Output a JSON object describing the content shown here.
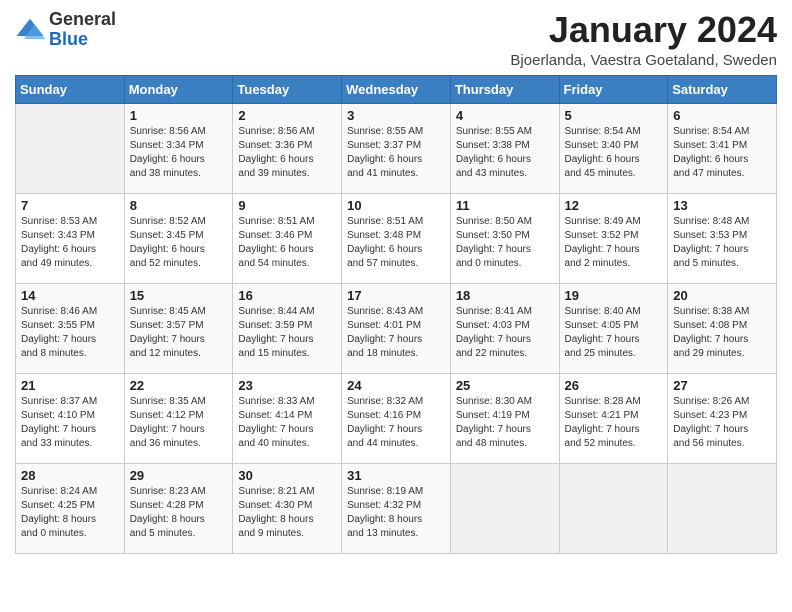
{
  "header": {
    "logo_general": "General",
    "logo_blue": "Blue",
    "month_year": "January 2024",
    "location": "Bjoerlanda, Vaestra Goetaland, Sweden"
  },
  "days_of_week": [
    "Sunday",
    "Monday",
    "Tuesday",
    "Wednesday",
    "Thursday",
    "Friday",
    "Saturday"
  ],
  "weeks": [
    [
      {
        "day": "",
        "info": ""
      },
      {
        "day": "1",
        "info": "Sunrise: 8:56 AM\nSunset: 3:34 PM\nDaylight: 6 hours\nand 38 minutes."
      },
      {
        "day": "2",
        "info": "Sunrise: 8:56 AM\nSunset: 3:36 PM\nDaylight: 6 hours\nand 39 minutes."
      },
      {
        "day": "3",
        "info": "Sunrise: 8:55 AM\nSunset: 3:37 PM\nDaylight: 6 hours\nand 41 minutes."
      },
      {
        "day": "4",
        "info": "Sunrise: 8:55 AM\nSunset: 3:38 PM\nDaylight: 6 hours\nand 43 minutes."
      },
      {
        "day": "5",
        "info": "Sunrise: 8:54 AM\nSunset: 3:40 PM\nDaylight: 6 hours\nand 45 minutes."
      },
      {
        "day": "6",
        "info": "Sunrise: 8:54 AM\nSunset: 3:41 PM\nDaylight: 6 hours\nand 47 minutes."
      }
    ],
    [
      {
        "day": "7",
        "info": "Sunrise: 8:53 AM\nSunset: 3:43 PM\nDaylight: 6 hours\nand 49 minutes."
      },
      {
        "day": "8",
        "info": "Sunrise: 8:52 AM\nSunset: 3:45 PM\nDaylight: 6 hours\nand 52 minutes."
      },
      {
        "day": "9",
        "info": "Sunrise: 8:51 AM\nSunset: 3:46 PM\nDaylight: 6 hours\nand 54 minutes."
      },
      {
        "day": "10",
        "info": "Sunrise: 8:51 AM\nSunset: 3:48 PM\nDaylight: 6 hours\nand 57 minutes."
      },
      {
        "day": "11",
        "info": "Sunrise: 8:50 AM\nSunset: 3:50 PM\nDaylight: 7 hours\nand 0 minutes."
      },
      {
        "day": "12",
        "info": "Sunrise: 8:49 AM\nSunset: 3:52 PM\nDaylight: 7 hours\nand 2 minutes."
      },
      {
        "day": "13",
        "info": "Sunrise: 8:48 AM\nSunset: 3:53 PM\nDaylight: 7 hours\nand 5 minutes."
      }
    ],
    [
      {
        "day": "14",
        "info": "Sunrise: 8:46 AM\nSunset: 3:55 PM\nDaylight: 7 hours\nand 8 minutes."
      },
      {
        "day": "15",
        "info": "Sunrise: 8:45 AM\nSunset: 3:57 PM\nDaylight: 7 hours\nand 12 minutes."
      },
      {
        "day": "16",
        "info": "Sunrise: 8:44 AM\nSunset: 3:59 PM\nDaylight: 7 hours\nand 15 minutes."
      },
      {
        "day": "17",
        "info": "Sunrise: 8:43 AM\nSunset: 4:01 PM\nDaylight: 7 hours\nand 18 minutes."
      },
      {
        "day": "18",
        "info": "Sunrise: 8:41 AM\nSunset: 4:03 PM\nDaylight: 7 hours\nand 22 minutes."
      },
      {
        "day": "19",
        "info": "Sunrise: 8:40 AM\nSunset: 4:05 PM\nDaylight: 7 hours\nand 25 minutes."
      },
      {
        "day": "20",
        "info": "Sunrise: 8:38 AM\nSunset: 4:08 PM\nDaylight: 7 hours\nand 29 minutes."
      }
    ],
    [
      {
        "day": "21",
        "info": "Sunrise: 8:37 AM\nSunset: 4:10 PM\nDaylight: 7 hours\nand 33 minutes."
      },
      {
        "day": "22",
        "info": "Sunrise: 8:35 AM\nSunset: 4:12 PM\nDaylight: 7 hours\nand 36 minutes."
      },
      {
        "day": "23",
        "info": "Sunrise: 8:33 AM\nSunset: 4:14 PM\nDaylight: 7 hours\nand 40 minutes."
      },
      {
        "day": "24",
        "info": "Sunrise: 8:32 AM\nSunset: 4:16 PM\nDaylight: 7 hours\nand 44 minutes."
      },
      {
        "day": "25",
        "info": "Sunrise: 8:30 AM\nSunset: 4:19 PM\nDaylight: 7 hours\nand 48 minutes."
      },
      {
        "day": "26",
        "info": "Sunrise: 8:28 AM\nSunset: 4:21 PM\nDaylight: 7 hours\nand 52 minutes."
      },
      {
        "day": "27",
        "info": "Sunrise: 8:26 AM\nSunset: 4:23 PM\nDaylight: 7 hours\nand 56 minutes."
      }
    ],
    [
      {
        "day": "28",
        "info": "Sunrise: 8:24 AM\nSunset: 4:25 PM\nDaylight: 8 hours\nand 0 minutes."
      },
      {
        "day": "29",
        "info": "Sunrise: 8:23 AM\nSunset: 4:28 PM\nDaylight: 8 hours\nand 5 minutes."
      },
      {
        "day": "30",
        "info": "Sunrise: 8:21 AM\nSunset: 4:30 PM\nDaylight: 8 hours\nand 9 minutes."
      },
      {
        "day": "31",
        "info": "Sunrise: 8:19 AM\nSunset: 4:32 PM\nDaylight: 8 hours\nand 13 minutes."
      },
      {
        "day": "",
        "info": ""
      },
      {
        "day": "",
        "info": ""
      },
      {
        "day": "",
        "info": ""
      }
    ]
  ]
}
